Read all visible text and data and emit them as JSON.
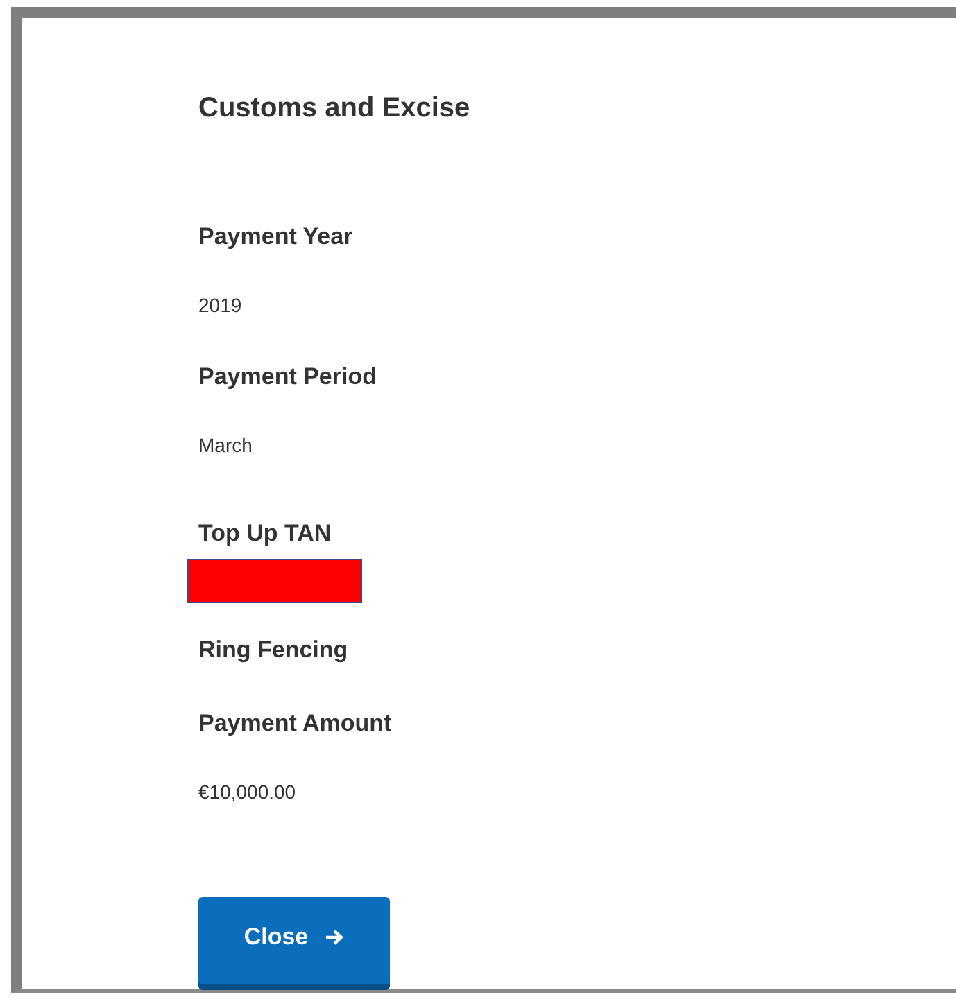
{
  "title": "Customs and Excise",
  "fields": [
    {
      "label": "Payment Year",
      "value": "2019"
    },
    {
      "label": "Payment Period",
      "value": "March"
    },
    {
      "label": "Top Up TAN",
      "redacted": true
    },
    {
      "label": "Ring Fencing"
    },
    {
      "label": "Payment Amount",
      "value": "€10,000.00"
    }
  ],
  "close_button": {
    "label": "Close"
  }
}
